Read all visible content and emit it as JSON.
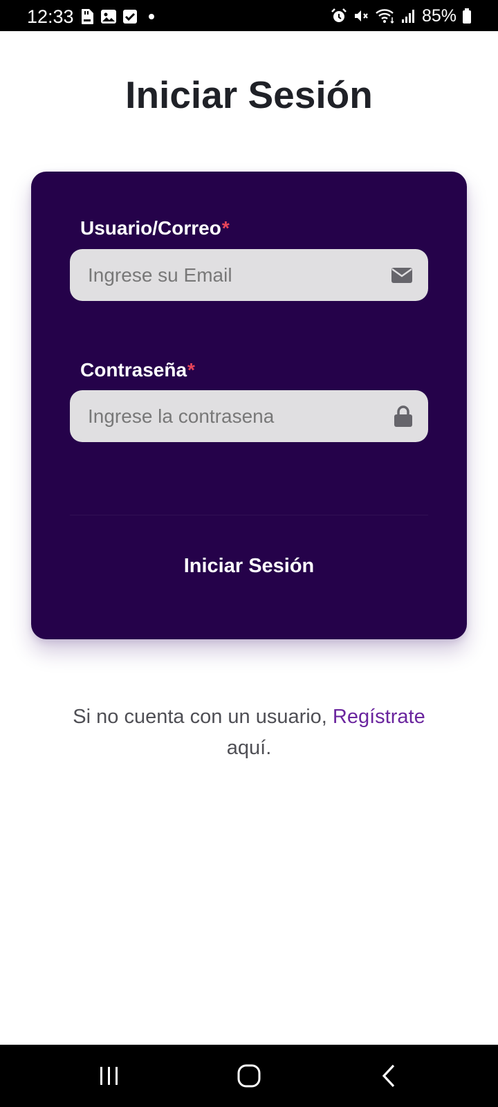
{
  "status_bar": {
    "time": "12:33",
    "battery": "85%",
    "left_icons": [
      "sd-card-icon",
      "image-icon",
      "checkbox-icon",
      "dot-icon"
    ],
    "right_icons": [
      "alarm-icon",
      "mute-icon",
      "wifi-icon",
      "signal-icon",
      "battery-icon"
    ]
  },
  "page": {
    "title": "Iniciar Sesión"
  },
  "form": {
    "email": {
      "label": "Usuario/Correo",
      "required_mark": "*",
      "placeholder": "Ingrese su Email",
      "value": "",
      "icon": "envelope-icon"
    },
    "password": {
      "label": "Contraseña",
      "required_mark": "*",
      "placeholder": "Ingrese la contrasena",
      "value": "",
      "icon": "lock-icon"
    },
    "submit_label": "Iniciar Sesión"
  },
  "register": {
    "prefix": "Si no cuenta con un usuario, ",
    "link_text": "Regístrate",
    "suffix": " aquí."
  },
  "nav_bar": {
    "buttons": [
      "recents-icon",
      "home-icon",
      "back-icon"
    ]
  },
  "colors": {
    "card_background": "#25024a",
    "accent_link": "#6a259e",
    "required": "#e8455a",
    "input_background": "#e0dfe1"
  }
}
